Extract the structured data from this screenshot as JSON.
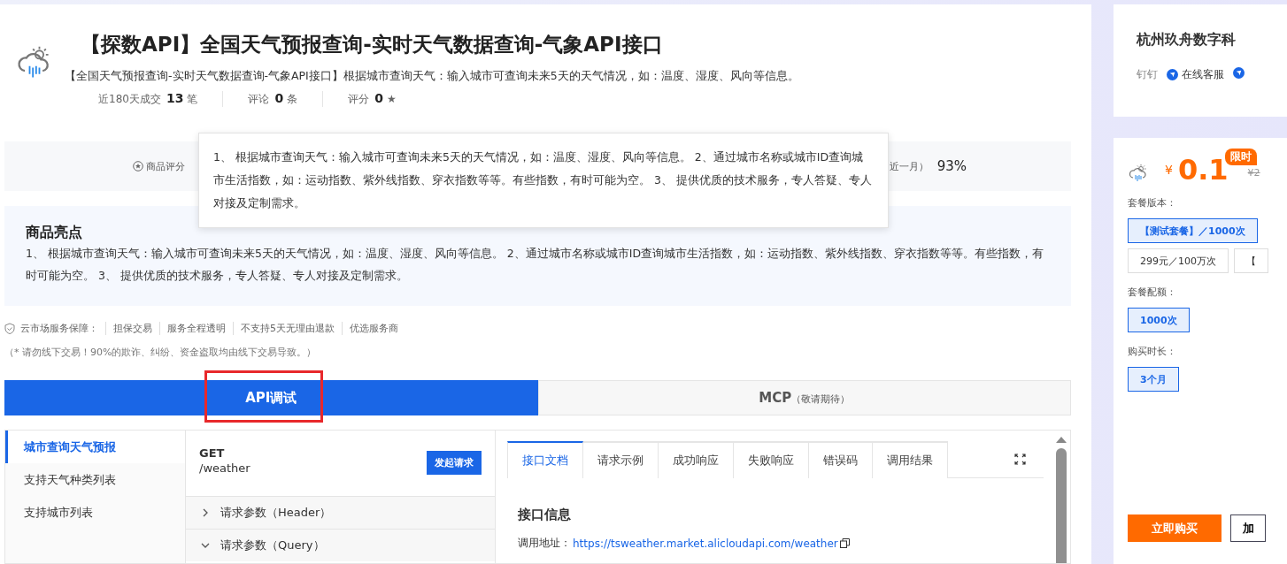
{
  "product": {
    "title": "【探数API】全国天气预报查询-实时天气数据查询-气象API接口",
    "description": "【全国天气预报查询-实时天气数据查询-气象API接口】根据城市查询天气：输入城市可查询未来5天的天气情况，如：温度、湿度、风向等信息。",
    "stats": [
      {
        "label": "近180天成交",
        "value": "13",
        "unit": "笔"
      },
      {
        "label": "评论",
        "value": "0",
        "unit": "条"
      },
      {
        "label": "评分",
        "value": "0",
        "unit": "★"
      }
    ]
  },
  "rating_bar": {
    "label": "商品评分",
    "partial_label": "近一月）",
    "percent": "93%"
  },
  "tooltip": {
    "text": "1、 根据城市查询天气：输入城市可查询未来5天的天气情况，如：温度、湿度、风向等信息。 2、通过城市名称或城市ID查询城市生活指数，如：运动指数、紫外线指数、穿衣指数等等。有些指数，有时可能为空。 3、 提供优质的技术服务，专人答疑、专人对接及定制需求。"
  },
  "highlights": {
    "title": "商品亮点",
    "text": "1、 根据城市查询天气：输入城市可查询未来5天的天气情况，如：温度、湿度、风向等信息。 2、通过城市名称或城市ID查询城市生活指数，如：运动指数、紫外线指数、穿衣指数等等。有些指数，有时可能为空。 3、 提供优质的技术服务，专人答疑、专人对接及定制需求。"
  },
  "guarantee": {
    "label": "云市场服务保障：",
    "items": [
      "担保交易",
      "服务全程透明",
      "不支持5天无理由退款",
      "优选服务商"
    ]
  },
  "warning": "（* 请勿线下交易！90%的欺诈、纠纷、资金盗取均由线下交易导致。）",
  "main_tabs": [
    {
      "label": "API调试",
      "selected": true,
      "highlighted": true
    },
    {
      "label": "MCP",
      "note": "（敬请期待）",
      "selected": false,
      "highlighted": false
    }
  ],
  "endpoints": [
    {
      "label": "城市查询天气预报",
      "selected": true
    },
    {
      "label": "支持天气种类列表",
      "selected": false
    },
    {
      "label": "支持城市列表",
      "selected": false
    }
  ],
  "request": {
    "method": "GET",
    "path": "/weather",
    "button": "发起请求",
    "sections": [
      {
        "label": "请求参数（Header）",
        "expanded": false
      },
      {
        "label": "请求参数（Query）",
        "expanded": true
      }
    ]
  },
  "doc_tabs": [
    {
      "label": "接口文档",
      "selected": true
    },
    {
      "label": "请求示例",
      "selected": false
    },
    {
      "label": "成功响应",
      "selected": false
    },
    {
      "label": "失败响应",
      "selected": false
    },
    {
      "label": "错误码",
      "selected": false
    },
    {
      "label": "调用结果",
      "selected": false
    }
  ],
  "doc": {
    "heading": "接口信息",
    "url_label": "调用地址：",
    "url": "https://tsweather.market.alicloudapi.com/weather"
  },
  "seller": {
    "name": "杭州玖舟数字科",
    "contacts": [
      {
        "kind": "plain",
        "label": "钉钉"
      },
      {
        "kind": "service",
        "label": "在线客服"
      },
      {
        "kind": "service-icon"
      }
    ]
  },
  "purchase": {
    "badge": "限时",
    "currency": "¥",
    "price": "0.1",
    "original": "¥2",
    "groups": [
      {
        "label": "套餐版本：",
        "options": [
          {
            "label": "【测试套餐】／1000次",
            "selected": true
          },
          {
            "label": "299元／100万次",
            "selected": false
          },
          {
            "label": "【",
            "selected": false
          }
        ]
      },
      {
        "label": "套餐配额：",
        "options": [
          {
            "label": "1000次",
            "selected": true
          }
        ]
      },
      {
        "label": "购买时长：",
        "options": [
          {
            "label": "3个月",
            "selected": true
          }
        ]
      }
    ],
    "buy_button": "立即购买",
    "cart_button": "加"
  }
}
